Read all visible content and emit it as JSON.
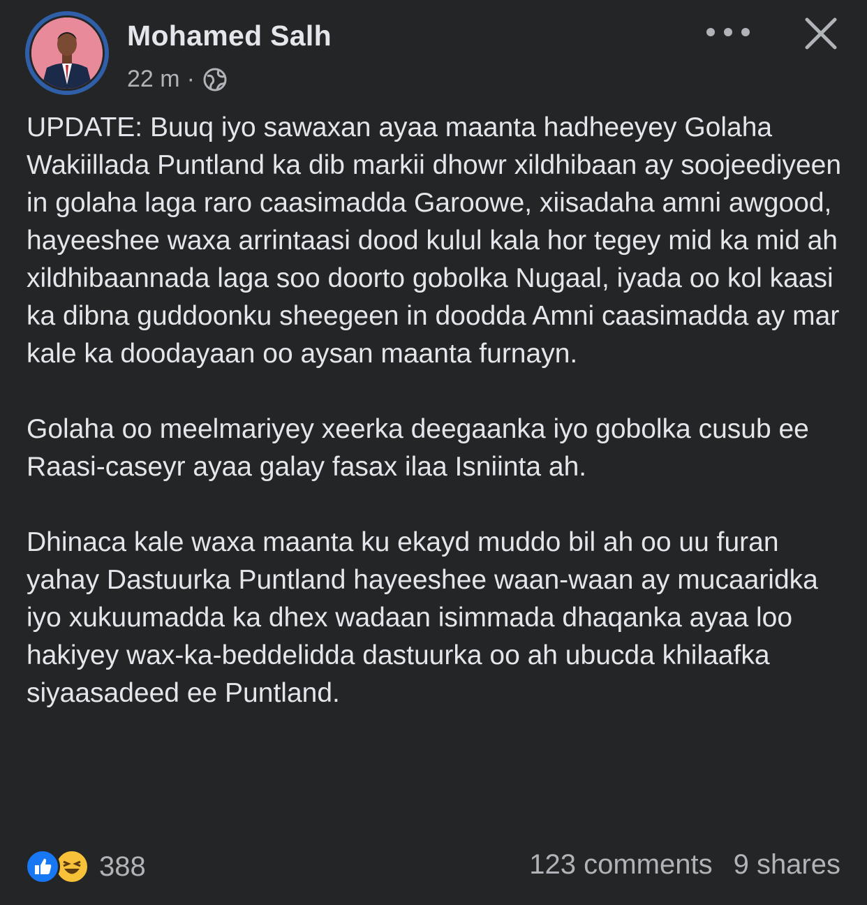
{
  "post": {
    "author": "Mohamed Salh",
    "time": "22 m",
    "separator": "·",
    "audience_icon": "globe-icon",
    "paragraphs": [
      "UPDATE: Buuq iyo sawaxan ayaa maanta hadheeyey Golaha Wakiillada Puntland ka dib markii dhowr xildhibaan ay soojeediyeen in golaha laga raro caasimadda Garoowe, xiisadaha amni awgood, hayeeshee waxa arrintaasi dood kulul kala hor tegey mid ka mid ah xildhibaannada laga soo doorto gobolka Nugaal, iyada oo kol kaasi ka dibna guddoonku sheegeen in doodda Amni caasimadda ay mar kale ka doodayaan oo aysan maanta furnayn.",
      "Golaha oo meelmariyey xeerka deegaanka iyo gobolka cusub ee Raasi-caseyr ayaa galay fasax ilaa Isniinta ah.",
      "Dhinaca kale waxa maanta ku ekayd muddo bil ah oo uu furan yahay Dastuurka Puntland hayeeshee waan-waan ay mucaaridka iyo xukuumadda ka dhex wadaan isimmada dhaqanka ayaa loo hakiyey wax-ka-beddelidda dastuurka oo ah ubucda khilaafka siyaasadeed ee Puntland."
    ]
  },
  "footer": {
    "reaction_icons": [
      "like-icon",
      "haha-icon"
    ],
    "reaction_count": "388",
    "comments": "123 comments",
    "shares": "9 shares"
  },
  "colors": {
    "background": "#242526",
    "primary_text": "#e4e6eb",
    "secondary_text": "#b0b3b8",
    "like_blue": "#1877f2",
    "haha_yellow": "#f7c13a"
  }
}
